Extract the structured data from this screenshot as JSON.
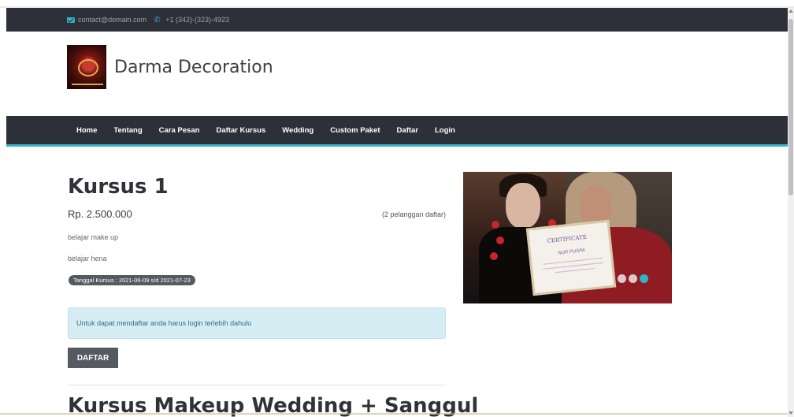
{
  "topbar": {
    "email": "contact@domain.com",
    "phone": "+1 (342)-(323)-4923"
  },
  "header": {
    "brand": "Darma Decoration"
  },
  "nav": {
    "items": [
      "Home",
      "Tentang",
      "Cara Pesan",
      "Daftar Kursus",
      "Wedding",
      "Custom Paket",
      "Daftar",
      "Login"
    ]
  },
  "course": {
    "title": "Kursus 1",
    "price": "Rp. 2.500.000",
    "subscribers": "(2 pelanggan daftar)",
    "descriptions": [
      "belajar make up",
      "belajar hena"
    ],
    "date_badge": "Tanggal Kursus : 2021-06-09 s/d 2021-07-23",
    "alert": "Untuk dapat mendaftar anda harus login terlebih dahulu",
    "button": "DAFTAR"
  },
  "next_course": {
    "title": "Kursus Makeup Wedding + Sanggul"
  },
  "carousel": {
    "certificate_title": "CERTIFICATE",
    "certificate_name": "NUR PUSPA",
    "slide_count": 3,
    "active_slide": 3,
    "accent": "#2fb3c8"
  },
  "colors": {
    "dark_bar": "#2d3039",
    "accent": "#2fb3c8",
    "alert_bg": "#d7edf4",
    "button_bg": "#555a60"
  }
}
